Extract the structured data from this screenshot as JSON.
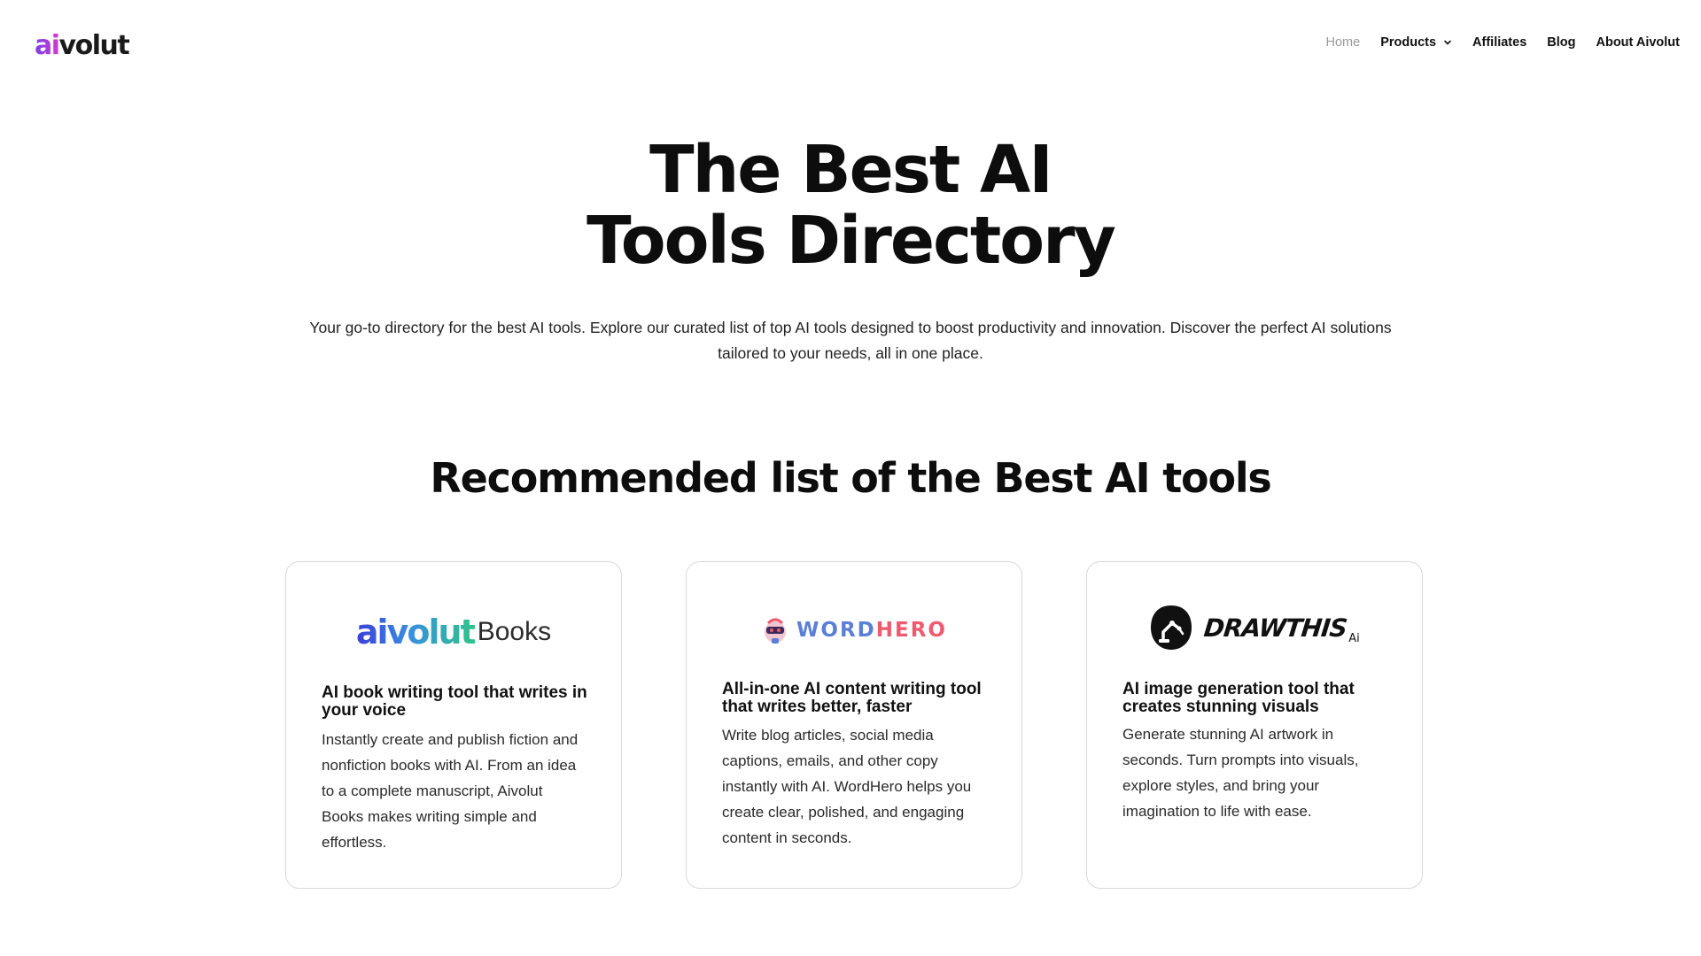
{
  "header": {
    "logo_prefix": "ai",
    "logo_suffix": "volut",
    "nav": {
      "home": "Home",
      "products": "Products",
      "affiliates": "Affiliates",
      "blog": "Blog",
      "about": "About Aivolut"
    }
  },
  "hero": {
    "title_line1": "The Best AI",
    "title_line2": "Tools Directory",
    "description": "Your go-to directory for the best AI tools. Explore our curated list of top AI tools designed to boost productivity and innovation. Discover the perfect AI solutions tailored to your needs, all in one place."
  },
  "section": {
    "title": "Recommended list of the Best AI tools"
  },
  "cards": [
    {
      "logo_main": "aivolut",
      "logo_sub": "Books",
      "title": "AI book writing tool that writes in your voice",
      "description": "Instantly create and publish fiction and nonfiction books with AI. From an idea to a complete manuscript, Aivolut Books makes writing simple and effortless."
    },
    {
      "logo_word": "WORD",
      "logo_hero": "HERO",
      "title": "All-in-one AI content writing tool that writes better, faster",
      "description": "Write blog articles, social media captions, emails, and other copy instantly with AI. WordHero helps you create clear, polished, and engaging content in seconds."
    },
    {
      "logo_main": "DRAWTHIS",
      "logo_sub": "Ai",
      "title": "AI image generation tool that creates stunning visuals",
      "description": "Generate stunning AI artwork in seconds. Turn prompts into visuals, explore styles, and bring your imagination to life with ease."
    }
  ],
  "colors": {
    "brand_purple": "#7b3fe4",
    "brand_pink": "#d23ad0",
    "nav_active": "#9a9a9a",
    "wordhero_blue": "#5b7fd6",
    "wordhero_red": "#ee5a6e",
    "card_border": "#d9d9d9"
  },
  "icons": {
    "products_dropdown": "chevron-down-icon",
    "wordhero_mascot": "robot-mascot-icon",
    "drawthis_emblem": "robot-arm-icon"
  }
}
